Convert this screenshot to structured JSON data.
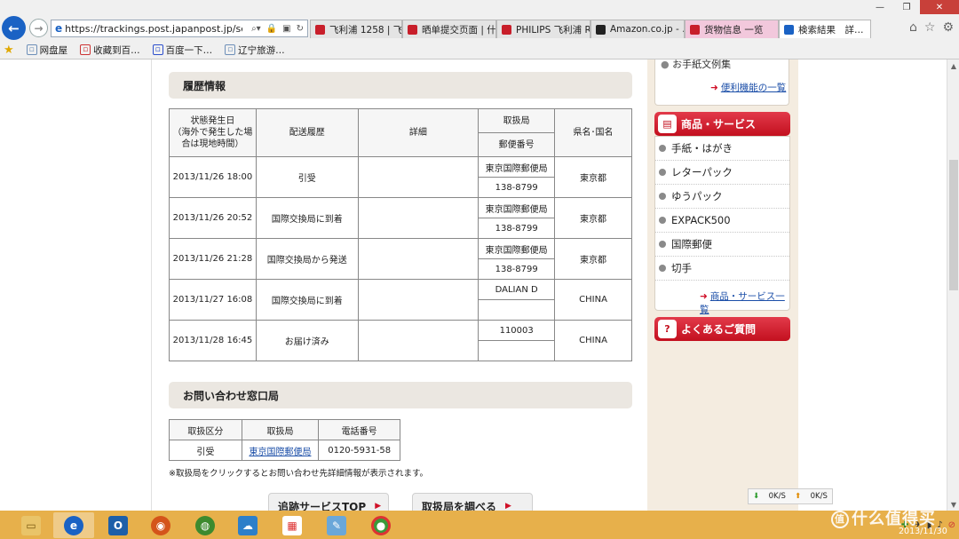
{
  "browser": {
    "url": "https://trackings.post.japanpost.jp/services/",
    "tabs": [
      {
        "label": "飞利浦 1258 | 飞…",
        "icon": "aliexpress-icon",
        "color": "#c81e2a",
        "width": 104
      },
      {
        "label": "晒单提交页面 | 什…",
        "icon": "aliexpress-icon",
        "color": "#c81e2a",
        "width": 106
      },
      {
        "label": "PHILIPS 飞利浦 R…",
        "icon": "aliexpress-icon",
        "color": "#c81e2a",
        "width": 106
      },
      {
        "label": "Amazon.co.jp - …",
        "icon": "amazon-icon",
        "color": "#222222",
        "width": 106
      },
      {
        "label": "货物信息 一览",
        "icon": "tracking-icon",
        "color": "#c81e2a",
        "width": 106,
        "pink": true
      },
      {
        "label": "検索結果　詳…",
        "icon": "ie-icon",
        "color": "#1a62c4",
        "width": 104,
        "active": true
      }
    ],
    "favorites": [
      {
        "label": "网盘屋",
        "icon": "page-icon"
      },
      {
        "label": "收藏到百…",
        "icon": "baidu-save-icon"
      },
      {
        "label": "百度一下…",
        "icon": "baidu-icon"
      },
      {
        "label": "辽宁旅游…",
        "icon": "page-icon"
      }
    ]
  },
  "history": {
    "title": "履歴情報",
    "headers": {
      "date": [
        "状態発生日",
        "（海外で発生した場",
        "合は現地時間）"
      ],
      "status": "配送履歴",
      "detail": "詳細",
      "office": "取扱局",
      "postal": "郵便番号",
      "region": "県名･国名"
    },
    "rows": [
      {
        "date": "2013/11/26 18:00",
        "status": "引受",
        "detail": "",
        "office": "東京国際郵便局",
        "postal": "138-8799",
        "region": "東京都"
      },
      {
        "date": "2013/11/26 20:52",
        "status": "国際交換局に到着",
        "detail": "",
        "office": "東京国際郵便局",
        "postal": "138-8799",
        "region": "東京都"
      },
      {
        "date": "2013/11/26 21:28",
        "status": "国際交換局から発送",
        "detail": "",
        "office": "東京国際郵便局",
        "postal": "138-8799",
        "region": "東京都"
      },
      {
        "date": "2013/11/27 16:08",
        "status": "国際交換局に到着",
        "detail": "",
        "office": "DALIAN D",
        "postal": "",
        "region": "CHINA"
      },
      {
        "date": "2013/11/28 16:45",
        "status": "お届け済み",
        "detail": "",
        "office": "110003",
        "postal": "",
        "region": "CHINA"
      }
    ]
  },
  "contact": {
    "title": "お問い合わせ窓口局",
    "headers": [
      "取扱区分",
      "取扱局",
      "電話番号"
    ],
    "row": {
      "category": "引受",
      "office": "東京国際郵便局",
      "phone": "0120-5931-58"
    },
    "note": "※取扱局をクリックするとお問い合わせ先詳細情報が表示されます。"
  },
  "buttons": {
    "top": "追跡サービスTOP",
    "find": "取扱局を調べる"
  },
  "sidebar": {
    "prev_item": "お手紙文例集",
    "prev_link": "便利機能の一覧",
    "services_title": "商品・サービス",
    "services": [
      "手紙・はがき",
      "レターパック",
      "ゆうパック",
      "EXPACK500",
      "国際郵便",
      "切手"
    ],
    "services_link": "商品・サービス一覧",
    "faq_title": "よくあるご質問"
  },
  "speed": {
    "down": "0K/S",
    "up": "0K/S"
  },
  "watermark": "什么值得买",
  "clock": "2013/11/30",
  "colors": {
    "accent_red": "#c3101f",
    "link_blue": "#1c4fa8",
    "taskbar": "#e7b04b",
    "ie_blue": "#1a62c4"
  }
}
